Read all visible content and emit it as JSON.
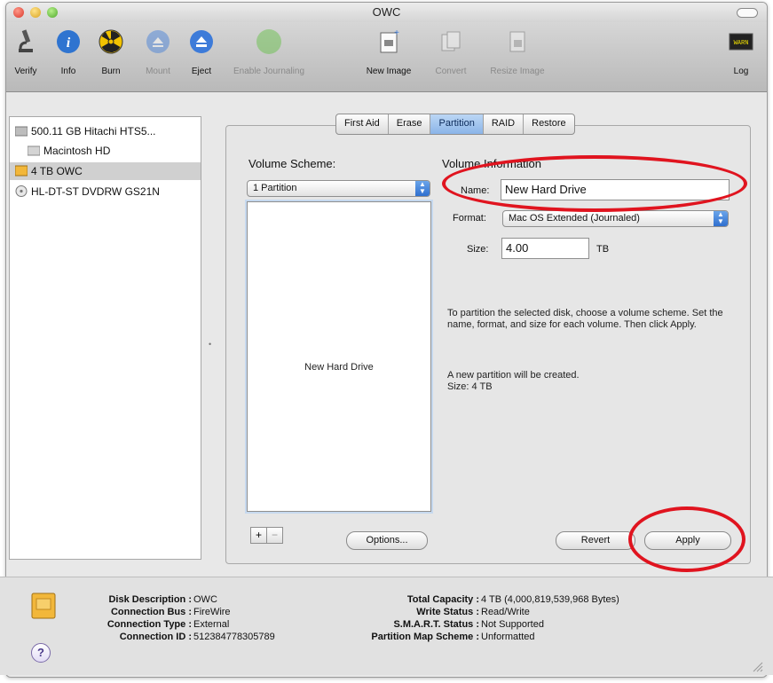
{
  "window": {
    "title": "OWC"
  },
  "toolbar": {
    "verify": "Verify",
    "info": "Info",
    "burn": "Burn",
    "mount": "Mount",
    "eject": "Eject",
    "enable_journaling": "Enable Journaling",
    "new_image": "New Image",
    "convert": "Convert",
    "resize_image": "Resize Image",
    "log": "Log"
  },
  "sidebar": {
    "items": [
      {
        "label": "500.11 GB Hitachi HTS5...",
        "icon": "hard-disk-icon"
      },
      {
        "label": "Macintosh HD",
        "icon": "volume-icon"
      },
      {
        "label": "4 TB OWC",
        "icon": "external-disk-icon"
      },
      {
        "label": "HL-DT-ST DVDRW GS21N",
        "icon": "optical-drive-icon"
      }
    ]
  },
  "tabs": [
    "First Aid",
    "Erase",
    "Partition",
    "RAID",
    "Restore"
  ],
  "partition": {
    "volume_scheme_label": "Volume Scheme:",
    "scheme_value": "1 Partition",
    "layout_partition_name": "New Hard Drive",
    "volume_info_label": "Volume Information",
    "name_label": "Name:",
    "name_value": "New Hard Drive",
    "format_label": "Format:",
    "format_value": "Mac OS Extended (Journaled)",
    "size_label": "Size:",
    "size_value": "4.00",
    "size_unit": "TB",
    "instructions": "To partition the selected disk, choose a volume scheme. Set the name, format, and size for each volume. Then click Apply.",
    "status_line1": "A new partition will be created.",
    "status_line2": "Size: 4 TB",
    "options_label": "Options...",
    "revert_label": "Revert",
    "apply_label": "Apply",
    "add_symbol": "+",
    "remove_symbol": "−"
  },
  "disk_info": {
    "left": [
      {
        "key": "Disk Description :",
        "value": "OWC"
      },
      {
        "key": "Connection Bus :",
        "value": "FireWire"
      },
      {
        "key": "Connection Type :",
        "value": "External"
      },
      {
        "key": "Connection ID :",
        "value": "512384778305789"
      }
    ],
    "right": [
      {
        "key": "Total Capacity :",
        "value": "4 TB (4,000,819,539,968 Bytes)"
      },
      {
        "key": "Write Status :",
        "value": "Read/Write"
      },
      {
        "key": "S.M.A.R.T. Status :",
        "value": "Not Supported"
      },
      {
        "key": "Partition Map Scheme :",
        "value": "Unformatted"
      }
    ],
    "help_symbol": "?"
  },
  "colors": {
    "accent": "#3d7bd9",
    "highlight_ring": "#e0141f"
  }
}
